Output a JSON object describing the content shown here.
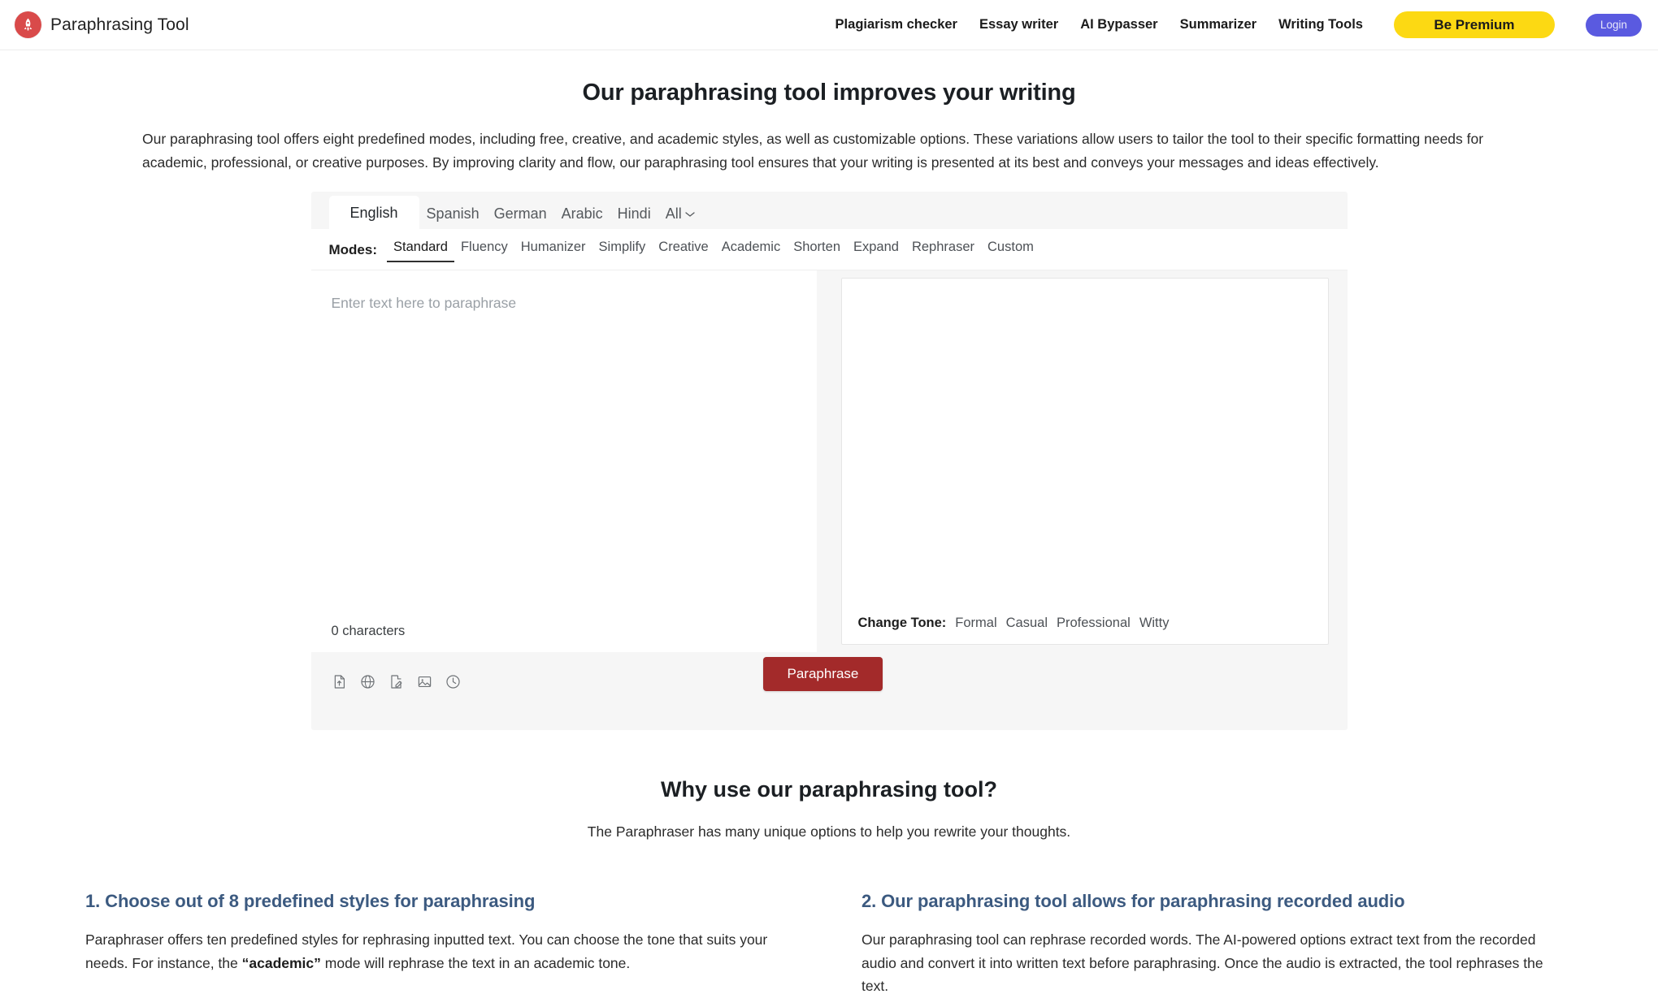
{
  "header": {
    "brand": "Paraphrasing Tool",
    "logo_icon": "rocket-logo-icon",
    "logo_color": "#d94a4a",
    "nav": [
      {
        "label": "Plagiarism checker"
      },
      {
        "label": "Essay writer"
      },
      {
        "label": "AI Bypasser"
      },
      {
        "label": "Summarizer"
      },
      {
        "label": "Writing Tools"
      }
    ],
    "premium_label": "Be Premium",
    "premium_color": "#fcd913",
    "login_label": "Login",
    "login_color": "#5a5ae0"
  },
  "hero": {
    "title": "Our paraphrasing tool improves your writing",
    "body": "Our paraphrasing tool offers eight predefined modes, including free, creative, and academic styles, as well as customizable options. These variations allow users to tailor the tool to their specific formatting needs for academic, professional, or creative purposes. By improving clarity and flow, our paraphrasing tool ensures that your writing is presented at its best and conveys your messages and ideas effectively."
  },
  "tool": {
    "languages": [
      {
        "label": "English",
        "active": true
      },
      {
        "label": "Spanish",
        "active": false
      },
      {
        "label": "German",
        "active": false
      },
      {
        "label": "Arabic",
        "active": false
      },
      {
        "label": "Hindi",
        "active": false
      },
      {
        "label": "All",
        "active": false,
        "has_chevron": true
      }
    ],
    "modes_label": "Modes:",
    "modes": [
      {
        "label": "Standard",
        "active": true
      },
      {
        "label": "Fluency",
        "active": false
      },
      {
        "label": "Humanizer",
        "active": false
      },
      {
        "label": "Simplify",
        "active": false
      },
      {
        "label": "Creative",
        "active": false
      },
      {
        "label": "Academic",
        "active": false
      },
      {
        "label": "Shorten",
        "active": false
      },
      {
        "label": "Expand",
        "active": false
      },
      {
        "label": "Rephraser",
        "active": false
      },
      {
        "label": "Custom",
        "active": false
      }
    ],
    "input_placeholder": "Enter text here to paraphrase",
    "input_value": "",
    "char_count": "0 characters",
    "output_value": "",
    "tone_label": "Change Tone:",
    "tones": [
      {
        "label": "Formal"
      },
      {
        "label": "Casual"
      },
      {
        "label": "Professional"
      },
      {
        "label": "Witty"
      }
    ],
    "action_icons": [
      {
        "name": "upload-document-icon"
      },
      {
        "name": "translate-globe-icon"
      },
      {
        "name": "edit-document-icon"
      },
      {
        "name": "upload-image-icon"
      },
      {
        "name": "history-clock-icon"
      }
    ],
    "paraphrase_label": "Paraphrase",
    "paraphrase_color": "#a32a2a"
  },
  "why": {
    "title": "Why use our paraphrasing tool?",
    "subtitle": "The Paraphraser has many unique options to help you rewrite your thoughts."
  },
  "features": [
    {
      "title": "1. Choose out of 8 predefined styles for paraphrasing",
      "body_part1": "Paraphraser offers ten predefined styles for rephrasing inputted text. You can choose the tone that suits your needs. For instance, the ",
      "body_bold": "“academic”",
      "body_part2": " mode will rephrase the text in an academic tone."
    },
    {
      "title": "2. Our paraphrasing tool allows for paraphrasing recorded audio",
      "body_part1": "Our paraphrasing tool can rephrase recorded words. The AI-powered options extract text from the recorded audio and convert it into written text before paraphrasing. Once the audio is extracted, the tool rephrases the text.",
      "body_bold": "",
      "body_part2": ""
    }
  ]
}
